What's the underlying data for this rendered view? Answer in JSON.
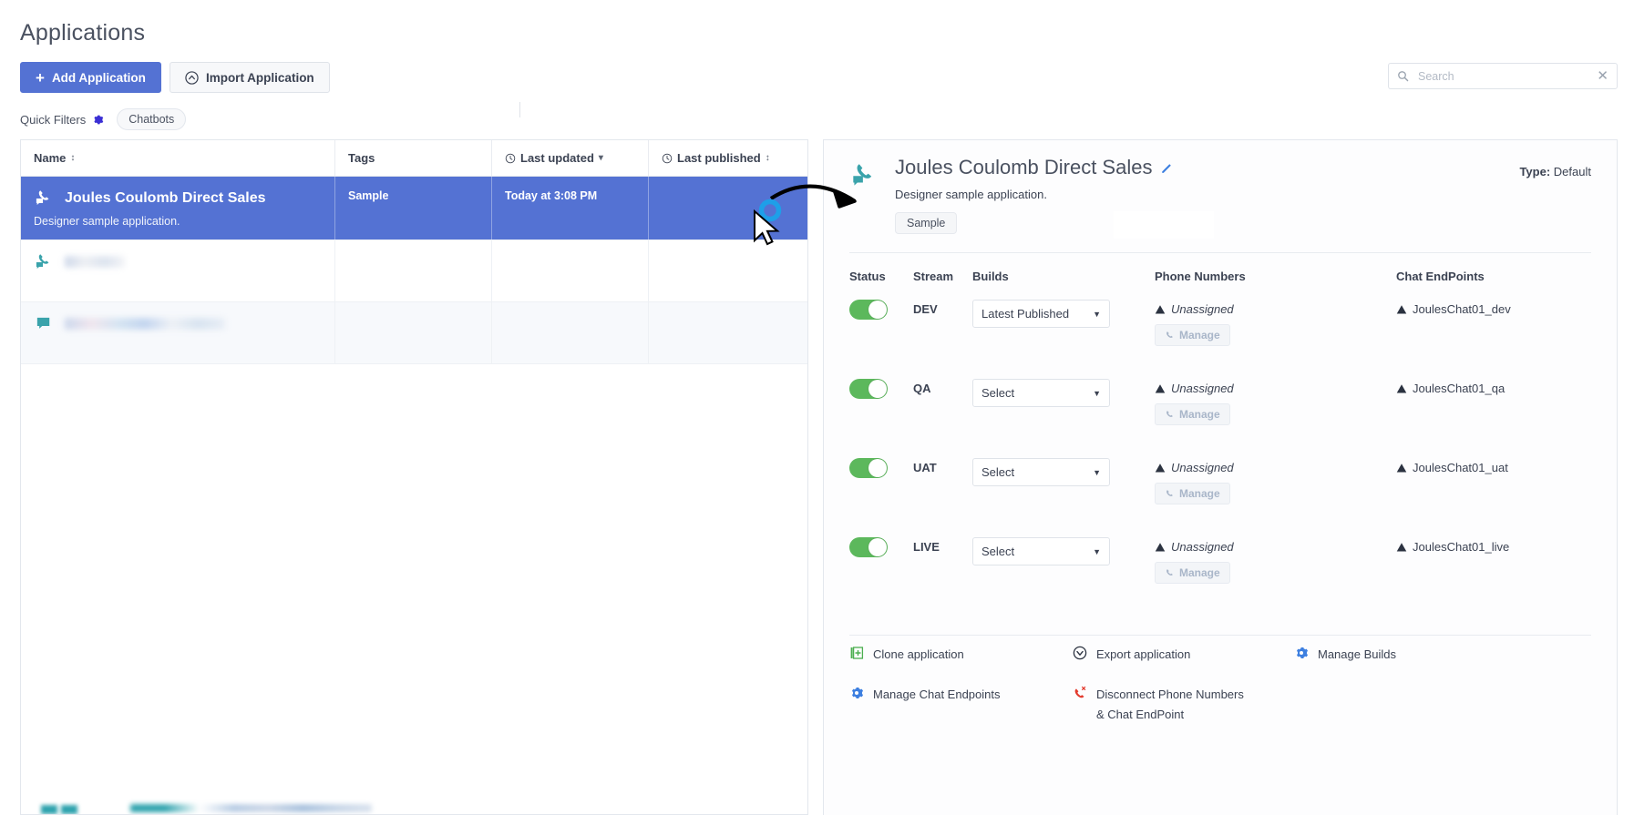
{
  "header": {
    "title": "Applications",
    "add_button": "Add Application",
    "import_button": "Import Application",
    "quick_filters_label": "Quick Filters",
    "chatbots_chip": "Chatbots"
  },
  "search": {
    "placeholder": "Search",
    "value": ""
  },
  "table": {
    "columns": [
      {
        "label": "Name",
        "sort": "↕"
      },
      {
        "label": "Tags",
        "sort": ""
      },
      {
        "label": "Last updated",
        "sort": "▾"
      },
      {
        "label": "Last published",
        "sort": "↕"
      }
    ],
    "rows": [
      {
        "icon": "phone-chat-icon",
        "name": "Joules Coulomb Direct Sales",
        "description": "Designer sample application.",
        "tags": "Sample",
        "last_updated": "Today at 3:08 PM",
        "last_published": "",
        "selected": true
      },
      {
        "icon": "phone-chat-icon",
        "name": "",
        "description": "",
        "tags": "",
        "last_updated": "",
        "last_published": "",
        "selected": false
      },
      {
        "icon": "chat-bubble-icon",
        "name": "",
        "description": "",
        "tags": "",
        "last_updated": "",
        "last_published": "",
        "selected": false
      }
    ]
  },
  "detail": {
    "title": "Joules Coulomb Direct Sales",
    "description": "Designer sample application.",
    "tag": "Sample",
    "type_label": "Type:",
    "type_value": "Default",
    "stream_headers": {
      "status": "Status",
      "stream": "Stream",
      "builds": "Builds",
      "phone_numbers": "Phone Numbers",
      "chat_endpoints": "Chat EndPoints"
    },
    "manage_label": "Manage",
    "unassigned_label": "Unassigned",
    "streams": [
      {
        "name": "DEV",
        "enabled": true,
        "build": "Latest Published",
        "phone": "Unassigned",
        "endpoint": "JoulesChat01_dev"
      },
      {
        "name": "QA",
        "enabled": true,
        "build": "Select",
        "phone": "Unassigned",
        "endpoint": "JoulesChat01_qa"
      },
      {
        "name": "UAT",
        "enabled": true,
        "build": "Select",
        "phone": "Unassigned",
        "endpoint": "JoulesChat01_uat"
      },
      {
        "name": "LIVE",
        "enabled": true,
        "build": "Select",
        "phone": "Unassigned",
        "endpoint": "JoulesChat01_live"
      }
    ],
    "actions": [
      {
        "icon": "clone-icon",
        "label": "Clone application"
      },
      {
        "icon": "export-icon",
        "label": "Export application"
      },
      {
        "icon": "gear-icon",
        "label": "Manage Builds"
      },
      {
        "icon": "gear-icon",
        "label": "Manage Chat Endpoints"
      },
      {
        "icon": "phone-disconnect-icon",
        "label": "Disconnect Phone Numbers & Chat EndPoint"
      }
    ]
  },
  "colors": {
    "primary_blue": "#5472d3",
    "toggle_green": "#5cb85c",
    "teal_icon": "#3aa3ab",
    "annotation_blue": "#1e9fe8",
    "warning": "#3b4252"
  }
}
